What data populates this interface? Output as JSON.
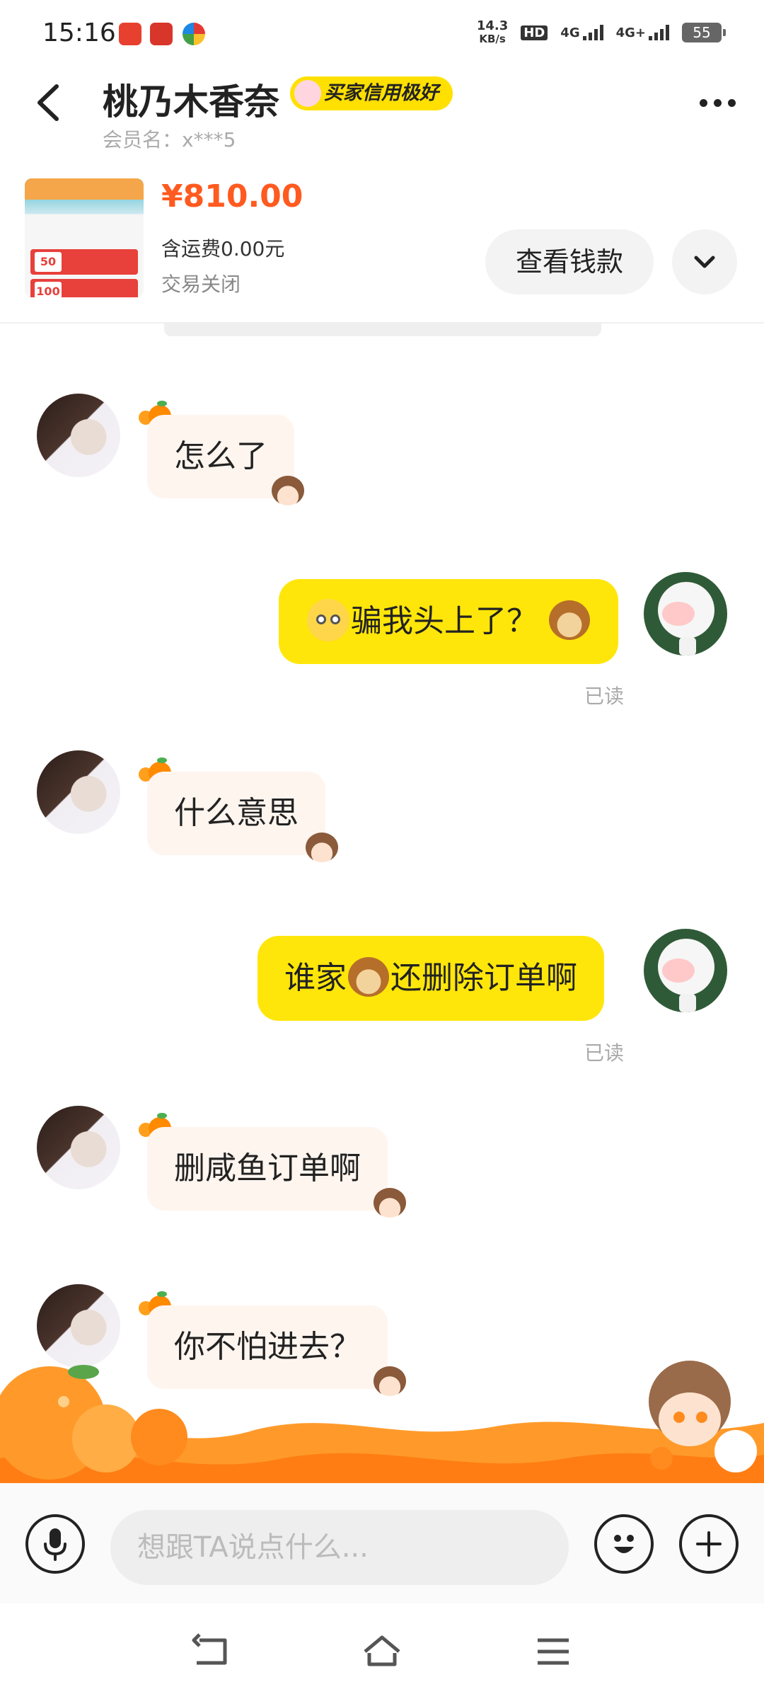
{
  "status_bar": {
    "time": "15:16",
    "speed_value": "14.3",
    "speed_unit": "KB/s",
    "hd": "HD",
    "sim1": "4G",
    "sim2": "4G+",
    "battery": "55"
  },
  "header": {
    "title": "桃乃木香奈",
    "badge": "买家信用极好",
    "member": "会员名：x***5"
  },
  "product": {
    "price": "¥810.00",
    "shipping": "含运费0.00元",
    "status": "交易关闭",
    "view_button": "查看钱款",
    "img_tag1": "50",
    "img_tag2": "100"
  },
  "messages": [
    {
      "text": "怎么了"
    },
    {
      "text_a": "骗我头上了？"
    },
    {
      "text": "什么意思"
    },
    {
      "text_a": "谁家",
      "text_b": "还删除订单啊"
    },
    {
      "text": "删咸鱼订单啊"
    },
    {
      "text": "你不怕进去？"
    }
  ],
  "read_label": "已读",
  "input": {
    "placeholder": "想跟TA说点什么..."
  },
  "colors": {
    "accent_yellow": "#ffe60a",
    "price_orange": "#ff5a1f",
    "incoming_bubble": "#fff5ef"
  }
}
